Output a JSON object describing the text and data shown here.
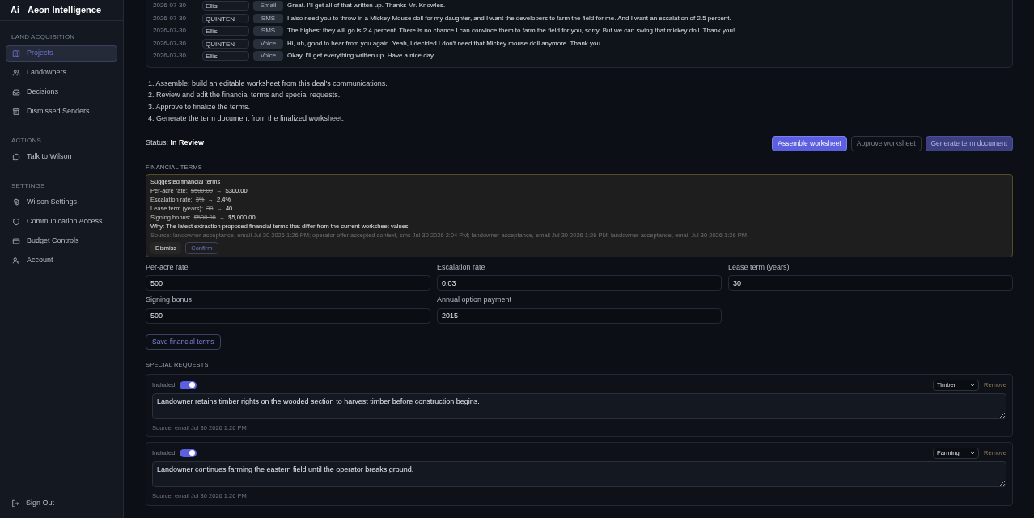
{
  "app": {
    "logo": "Ai",
    "name": "Aeon Intelligence"
  },
  "sidebar": {
    "sections": [
      {
        "title": "LAND ACQUISITION",
        "items": [
          {
            "label": "Projects",
            "selected": true
          },
          {
            "label": "Landowners",
            "selected": false
          },
          {
            "label": "Decisions",
            "selected": false
          },
          {
            "label": "Dismissed Senders",
            "selected": false
          }
        ]
      },
      {
        "title": "ACTIONS",
        "items": [
          {
            "label": "Talk to Wilson",
            "selected": false
          }
        ]
      },
      {
        "title": "SETTINGS",
        "items": [
          {
            "label": "Wilson Settings",
            "selected": false
          },
          {
            "label": "Communication Access",
            "selected": false
          },
          {
            "label": "Budget Controls",
            "selected": false
          },
          {
            "label": "Account",
            "selected": false
          }
        ]
      }
    ],
    "sign_out": "Sign Out"
  },
  "messages": [
    {
      "date": "2026-07-30",
      "sender": "Ellis",
      "channel": "Email",
      "text": "Great. I'll get all of that written up. Thanks Mr. Knowles."
    },
    {
      "date": "2026-07-30",
      "sender": "QUINTEN",
      "channel": "SMS",
      "text": "I also need you to throw in a Mickey Mouse doll for my daughter, and I want the developers to farm the field for me. And I want an escalation of 2.5 percent."
    },
    {
      "date": "2026-07-30",
      "sender": "Ellis",
      "channel": "SMS",
      "text": "The highest they will go is 2.4 percent. There is no chance I can convince them to farm the field for you, sorry. But we can swing that mickey doll. Thank you!"
    },
    {
      "date": "2026-07-30",
      "sender": "QUINTEN",
      "channel": "Voice",
      "text": "Hi, uh, good to hear from you again. Yeah, I decided I don't need that Mickey mouse doll anymore. Thank you."
    },
    {
      "date": "2026-07-30",
      "sender": "Ellis",
      "channel": "Voice",
      "text": "Okay. I'll get everything written up. Have a nice day"
    }
  ],
  "steps": [
    "1. Assemble: build an editable worksheet from this deal's communications.",
    "2. Review and edit the financial terms and special requests.",
    "3. Approve to finalize the terms.",
    "4. Generate the term document from the finalized worksheet."
  ],
  "status": {
    "label": "Status:",
    "value": "In Review"
  },
  "actions": [
    {
      "label": "Assemble worksheet",
      "kind": "primary",
      "disabled": false
    },
    {
      "label": "Approve worksheet",
      "kind": "outline",
      "disabled": true
    },
    {
      "label": "Generate term document",
      "kind": "accent",
      "disabled": true
    }
  ],
  "financial_terms": {
    "heading": "FINANCIAL TERMS",
    "suggestion": {
      "title": "Suggested financial terms",
      "changes": [
        {
          "label": "Per-acre rate:",
          "old": "$500.00",
          "arrow": "→",
          "new": "$300.00"
        },
        {
          "label": "Escalation rate:",
          "old": "3%",
          "arrow": "→",
          "new": "2.4%"
        },
        {
          "label": "Lease term (years):",
          "old": "30",
          "arrow": "→",
          "new": "40"
        },
        {
          "label": "Signing bonus:",
          "old": "$500.00",
          "arrow": "→",
          "new": "$5,000.00"
        }
      ],
      "why": "Why: The latest extraction proposed financial terms that differ from the current worksheet values.",
      "source": "Source: landowner acceptance, email Jul 30 2026 1:26 PM; operator offer accepted context, sms Jul 30 2026 2:04 PM; landowner acceptance, email Jul 30 2026 1:26 PM; landowner acceptance, email Jul 30 2026 1:26 PM",
      "buttons": [
        "Dismiss",
        "Confirm"
      ]
    },
    "fields": [
      {
        "label": "Per-acre rate",
        "value": "500"
      },
      {
        "label": "Escalation rate",
        "value": "0.03"
      },
      {
        "label": "Lease term (years)",
        "value": "30"
      },
      {
        "label": "Signing bonus",
        "value": "500"
      },
      {
        "label": "Annual option payment",
        "value": "2015"
      }
    ],
    "save_button": "Save financial terms"
  },
  "special_requests": {
    "heading": "SPECIAL REQUESTS",
    "items": [
      {
        "included_label": "Included",
        "included": true,
        "category": "Timber",
        "remove": "Remove",
        "text": "Landowner retains timber rights on the wooded section to harvest timber before construction begins.",
        "source": "Source: email Jul 30 2026 1:26 PM"
      },
      {
        "included_label": "Included",
        "included": true,
        "category": "Farming",
        "remove": "Remove",
        "text": "Landowner continues farming the eastern field until the operator breaks ground.",
        "source": "Source: email Jul 30 2026 1:26 PM"
      }
    ]
  }
}
